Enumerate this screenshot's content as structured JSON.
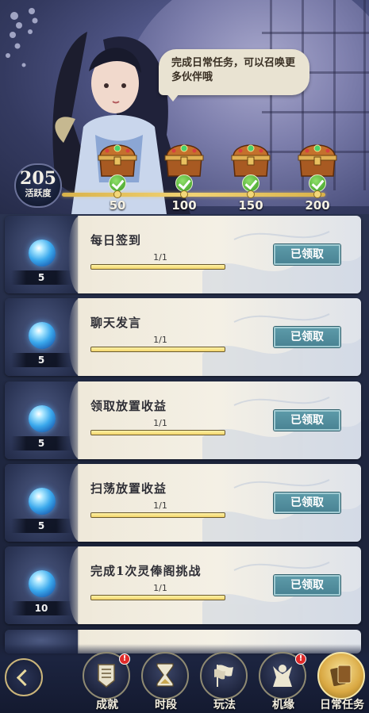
{
  "header": {
    "bubble_text": "完成日常任务，可以召唤更多伙伴哦",
    "activity_value": "205",
    "activity_label": "活跃度",
    "milestones": [
      {
        "label": "50",
        "claimed": true
      },
      {
        "label": "100",
        "claimed": true
      },
      {
        "label": "150",
        "claimed": true
      },
      {
        "label": "200",
        "claimed": true
      }
    ]
  },
  "tasks": [
    {
      "title": "每日签到",
      "progress": "1/1",
      "reward_qty": "5",
      "button": "已领取",
      "fill": 1.0
    },
    {
      "title": "聊天发言",
      "progress": "1/1",
      "reward_qty": "5",
      "button": "已领取",
      "fill": 1.0
    },
    {
      "title": "领取放置收益",
      "progress": "1/1",
      "reward_qty": "5",
      "button": "已领取",
      "fill": 1.0
    },
    {
      "title": "扫荡放置收益",
      "progress": "1/1",
      "reward_qty": "5",
      "button": "已领取",
      "fill": 1.0
    },
    {
      "title": "完成1次灵俸阁挑战",
      "progress": "1/1",
      "reward_qty": "10",
      "button": "已领取",
      "fill": 1.0
    }
  ],
  "nav": [
    {
      "label": "成就",
      "badge": "!",
      "icon": "scroll-shield-icon"
    },
    {
      "label": "时段",
      "badge": "",
      "icon": "hourglass-icon"
    },
    {
      "label": "玩法",
      "badge": "",
      "icon": "flags-icon"
    },
    {
      "label": "机缘",
      "badge": "!",
      "icon": "demon-figure-icon"
    },
    {
      "label": "日常任务",
      "badge": "",
      "icon": "cards-icon",
      "active": true
    }
  ],
  "colors": {
    "claimed_button": "#4a8494",
    "progress_fill": "#f2d46a",
    "badge": "#e02a2a"
  }
}
